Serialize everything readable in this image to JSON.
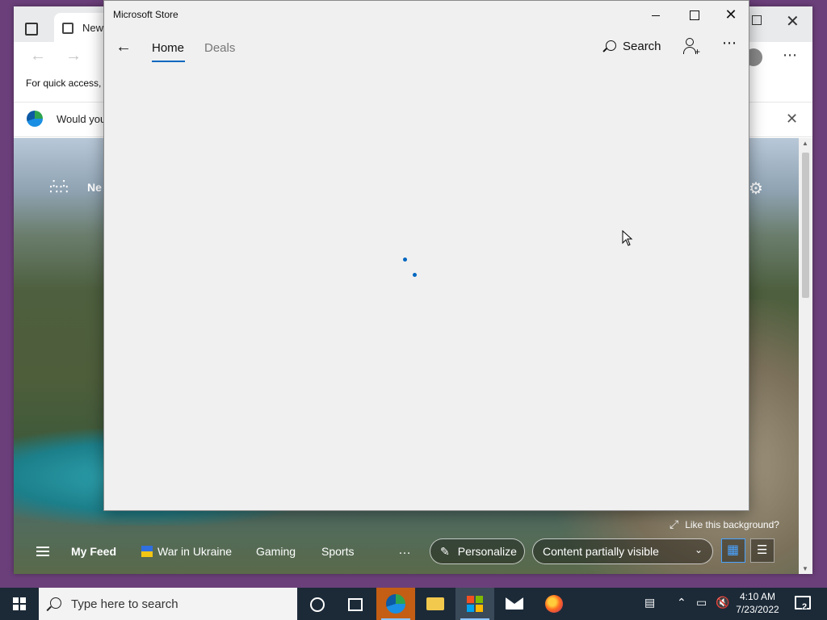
{
  "browser": {
    "tab_label": "New",
    "favorites_bar_text": "For quick access, p",
    "banner_text": "Would you",
    "new_tab": {
      "title": "Ne",
      "like_background": "Like this background?",
      "feed": {
        "my_feed": "My Feed",
        "items": [
          "War in Ukraine",
          "Gaming",
          "Sports"
        ],
        "more": "…",
        "personalize": "Personalize",
        "content_visibility": "Content partially visible"
      }
    }
  },
  "store": {
    "window_title": "Microsoft Store",
    "nav": {
      "tabs": [
        {
          "label": "Home",
          "active": true
        },
        {
          "label": "Deals",
          "active": false
        }
      ],
      "search_label": "Search"
    },
    "loading": true,
    "accent_color": "#0067c0"
  },
  "taskbar": {
    "search_placeholder": "Type here to search",
    "pinned_apps": [
      "cortana",
      "task-view",
      "microsoft-edge",
      "file-explorer",
      "microsoft-store",
      "mail",
      "firefox"
    ],
    "clock": {
      "time": "4:10 AM",
      "date": "7/23/2022"
    },
    "notification_count": "2"
  }
}
